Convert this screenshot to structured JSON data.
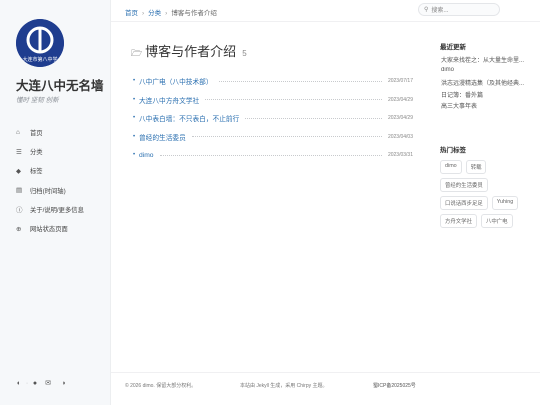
{
  "sidebar": {
    "avatar_text": "大连市第八中学",
    "title": "大连八中无名墙",
    "subtitle": "懂时 坚韧 创新",
    "nav": [
      {
        "icon": "home-icon",
        "glyph": "⌂",
        "label": "首页"
      },
      {
        "icon": "list-icon",
        "glyph": "☰",
        "label": "分类"
      },
      {
        "icon": "tag-icon",
        "glyph": "◆",
        "label": "标签"
      },
      {
        "icon": "archive-icon",
        "glyph": "▤",
        "label": "归档(时间轴)"
      },
      {
        "icon": "info-icon",
        "glyph": "ⓘ",
        "label": "关于/说明/更多信息"
      },
      {
        "icon": "globe-icon",
        "glyph": "⊕",
        "label": "网站状态页面"
      }
    ]
  },
  "topbar": {
    "breadcrumb": [
      "首页",
      "分类",
      "博客与作者介绍"
    ],
    "search_placeholder": "搜索..."
  },
  "main": {
    "title": "博客与作者介绍",
    "count": "5",
    "posts": [
      {
        "title": "八中广电（八中技术部）",
        "date": "2023/07/17"
      },
      {
        "title": "大连八中方舟文学社",
        "date": "2023/04/29"
      },
      {
        "title": "八中表白墙：不只表白，不止前行",
        "date": "2023/04/29"
      },
      {
        "title": "曾经的生活委员",
        "date": "2023/04/03"
      },
      {
        "title": "dimo",
        "date": "2023/03/31"
      }
    ]
  },
  "right": {
    "recent_heading": "最近更新",
    "recent": [
      "大家来找茬之：从大量生命里...",
      "dimo",
      "洪志远漫精选集（及其他经典...",
      "日记簿：番外篇",
      "高三大事年表"
    ],
    "tags_heading": "热门标签",
    "tags": [
      "dimo",
      "转载",
      "曾经的生活委员",
      "口说话西步足足",
      "Yuhing",
      "方舟文学社",
      "八中广电"
    ]
  },
  "footer": {
    "left": "© 2026 dimo. 保留大部分权利。",
    "mid": "本站由 Jekyll 生成，采用 Chirpy 主题。",
    "right": "蜀ICP备2025025号"
  }
}
